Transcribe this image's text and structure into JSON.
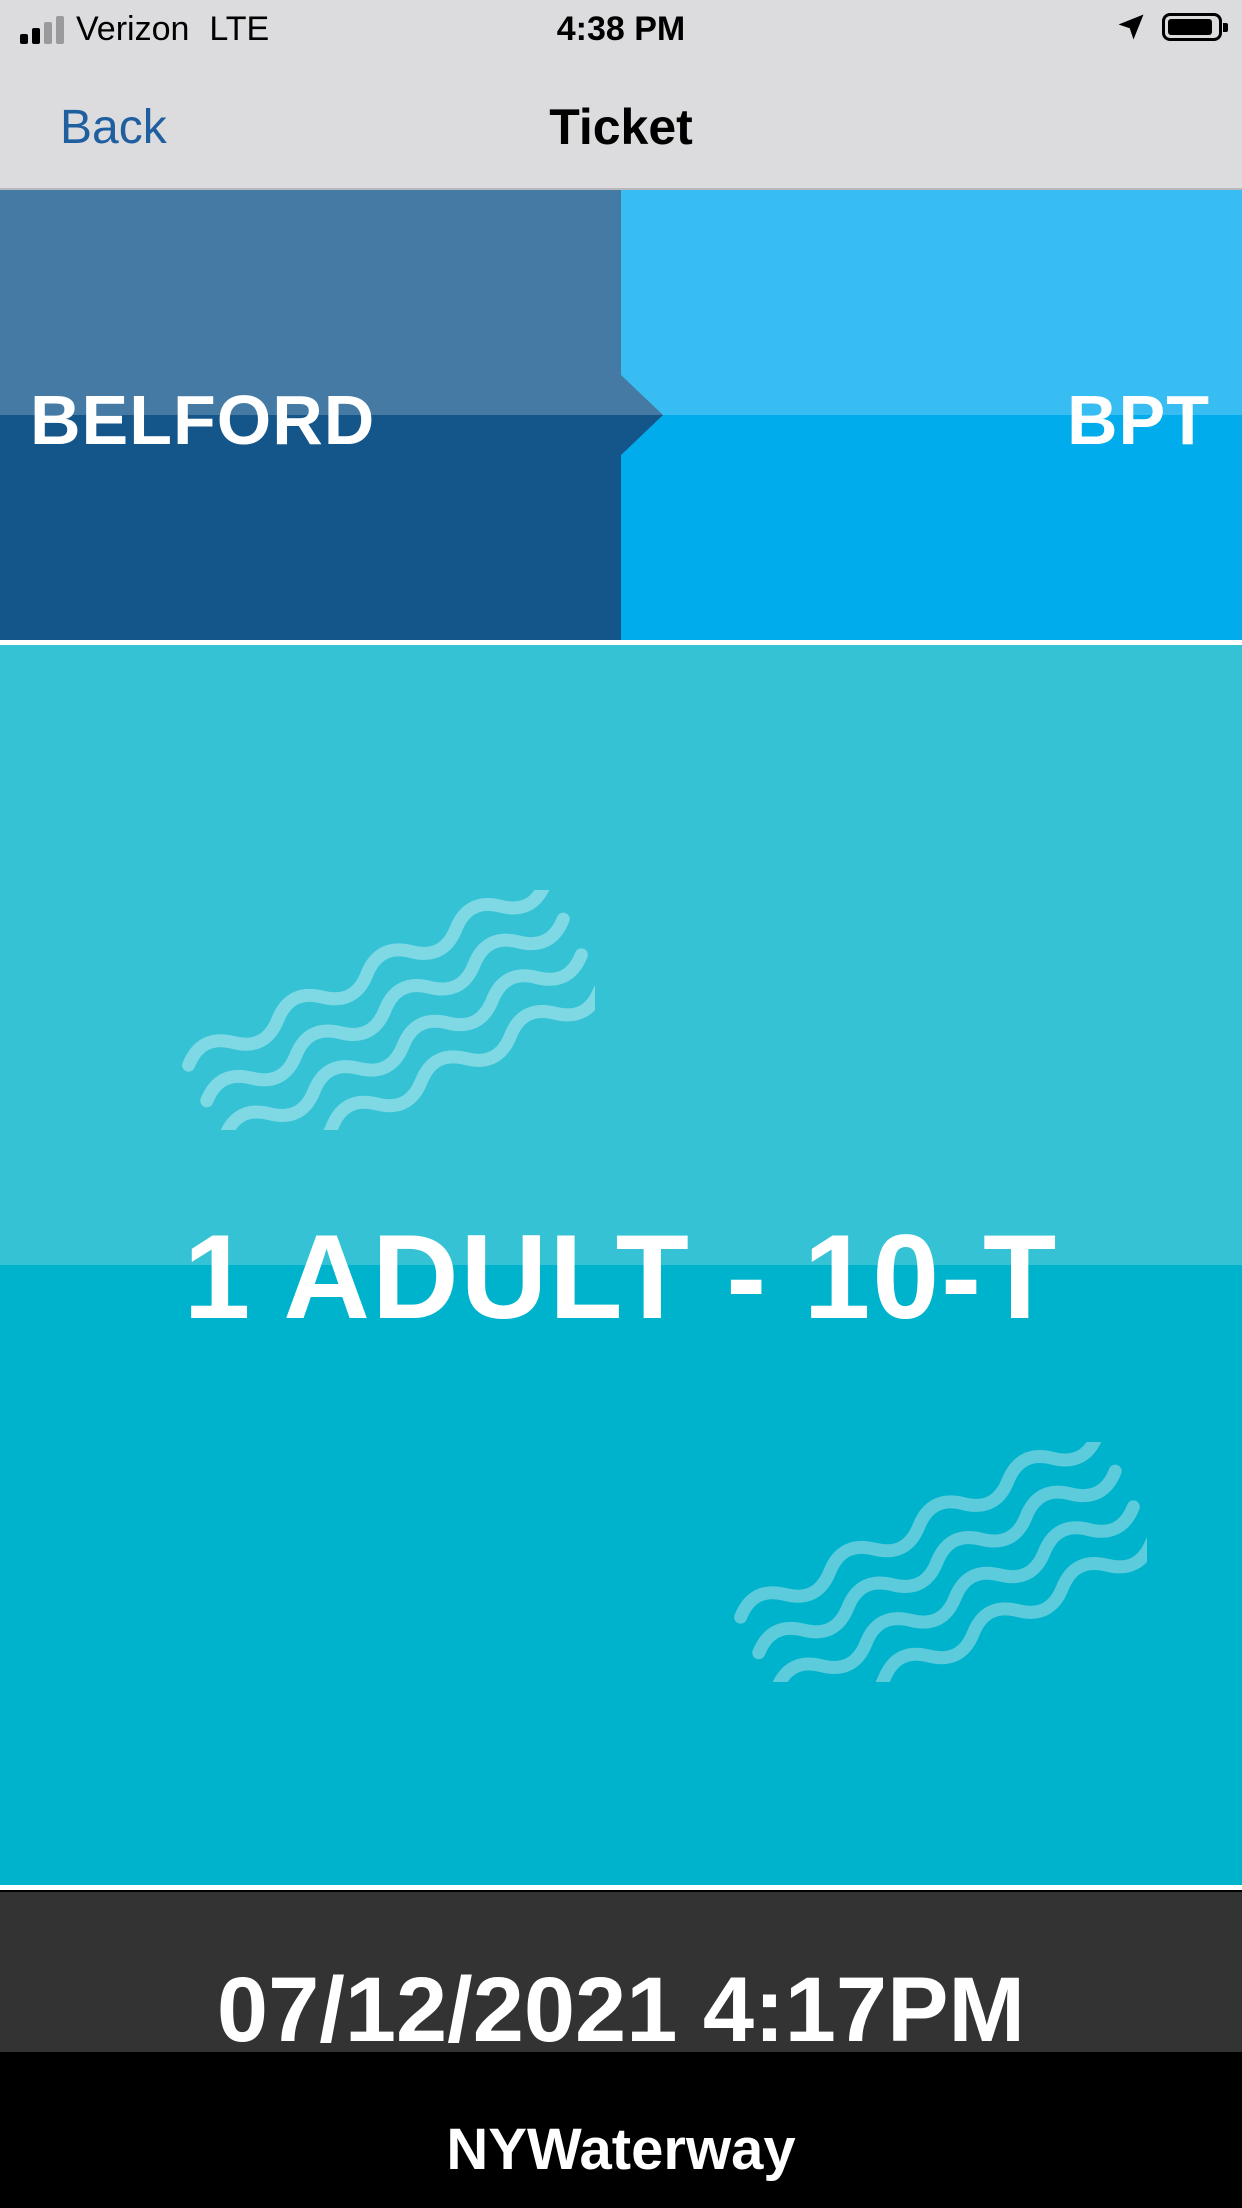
{
  "status_bar": {
    "carrier": "Verizon",
    "network": "LTE",
    "time": "4:38 PM",
    "location_icon": "location-arrow-icon",
    "battery_icon": "battery-icon",
    "signal_icon": "signal-icon"
  },
  "nav": {
    "back_label": "Back",
    "title": "Ticket"
  },
  "route": {
    "from": "BELFORD",
    "to": "BPT"
  },
  "ticket": {
    "type": "1 ADULT - 10-T",
    "datetime": "07/12/2021 4:17PM"
  },
  "footer": {
    "brand": "NYWaterway"
  },
  "colors": {
    "from_top": "#447aa3",
    "from_bottom": "#14568a",
    "to_top": "#38bdf2",
    "to_bottom": "#00acec",
    "ticket_top": "#35c2d4",
    "ticket_bottom": "#00b3cc",
    "date_bar": "#333333",
    "footer": "#000000",
    "nav_link": "#1f5fa0"
  }
}
